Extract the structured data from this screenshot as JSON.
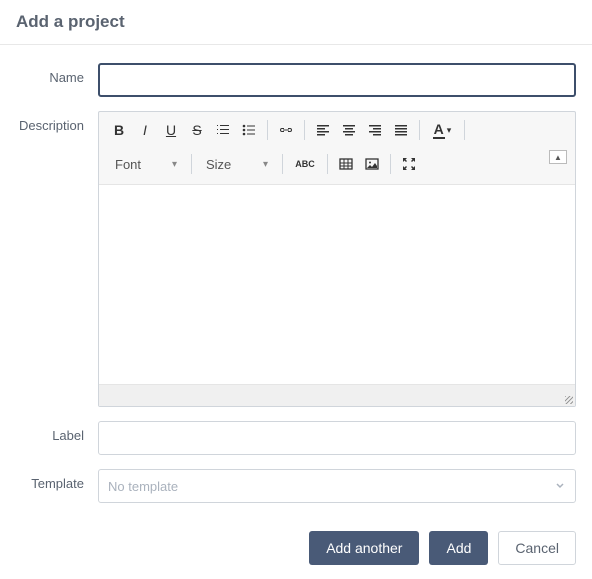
{
  "header": {
    "title": "Add a project"
  },
  "labels": {
    "name": "Name",
    "description": "Description",
    "label": "Label",
    "template": "Template"
  },
  "name_value": "",
  "label_value": "",
  "template": {
    "placeholder": "No template"
  },
  "toolbar": {
    "font_label": "Font",
    "size_label": "Size"
  },
  "actions": {
    "add_another": "Add another",
    "add": "Add",
    "cancel": "Cancel"
  }
}
